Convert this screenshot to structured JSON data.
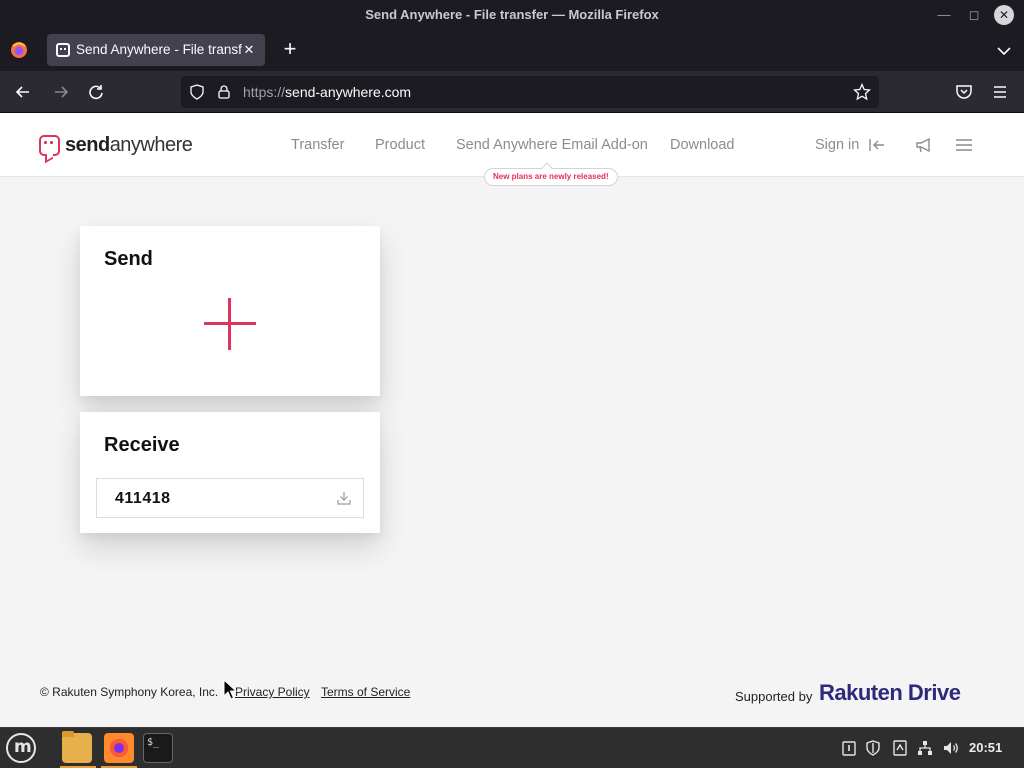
{
  "window": {
    "title": "Send Anywhere - File transfer — Mozilla Firefox"
  },
  "browser": {
    "tab_title": "Send Anywhere - File transfer",
    "url_scheme": "https://",
    "url_host": "send-anywhere.com"
  },
  "site": {
    "logo_bold": "send",
    "logo_rest": "anywhere",
    "nav": [
      {
        "label": "Transfer"
      },
      {
        "label": "Product"
      },
      {
        "label": "Send Anywhere Email Add-on"
      },
      {
        "label": "Download"
      }
    ],
    "new_plans_badge": "New plans are newly released!",
    "sign_in": "Sign in",
    "accent_color": "#e0325a"
  },
  "send_card": {
    "title": "Send"
  },
  "receive_card": {
    "title": "Receive",
    "key_value": "411418"
  },
  "footer": {
    "copyright": "© Rakuten Symphony Korea, Inc.",
    "privacy": "Privacy Policy",
    "terms": "Terms of Service",
    "supported_by": "Supported by",
    "sponsor_name_part1": "Rakuten",
    "sponsor_name_part2": "Drive"
  },
  "taskbar": {
    "clock": "20:51",
    "terminal_glyph": "$_"
  }
}
